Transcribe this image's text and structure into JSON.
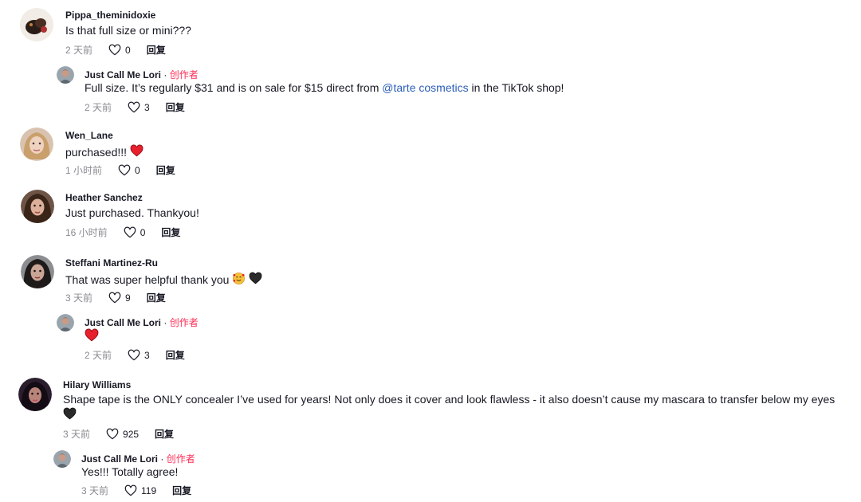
{
  "comments": [
    {
      "username": "Pippa_theminidoxie",
      "text": "Is that full size or mini???",
      "time": "2 天前",
      "likes": "0",
      "reply_label": "回复",
      "replies": [
        {
          "username": "Just Call Me Lori",
          "creator_label": "创作者",
          "text_before": "Full size. It’s regularly $31 and is on sale for $15 direct from ",
          "mention": "@tarte cosmetics",
          "text_after": " in the TikTok shop!",
          "time": "2 天前",
          "likes": "3",
          "reply_label": "回复"
        }
      ]
    },
    {
      "username": "Wen_Lane",
      "text": "purchased!!!",
      "time": "1 小时前",
      "likes": "0",
      "reply_label": "回复"
    },
    {
      "username": "Heather Sanchez",
      "text": "Just purchased. Thankyou!",
      "time": "16 小时前",
      "likes": "0",
      "reply_label": "回复"
    },
    {
      "username": "Steffani Martinez-Ru",
      "text": "That was super helpful thank you",
      "time": "3 天前",
      "likes": "9",
      "reply_label": "回复",
      "replies": [
        {
          "username": "Just Call Me Lori",
          "creator_label": "创作者",
          "time": "2 天前",
          "likes": "3",
          "reply_label": "回复"
        }
      ]
    },
    {
      "username": "Hilary Williams",
      "text": "Shape tape is the ONLY concealer I’ve used for years! Not only does it cover and look flawless - it also doesn’t cause my mascara to transfer below my eyes",
      "time": "3 天前",
      "likes": "925",
      "reply_label": "回复",
      "replies": [
        {
          "username": "Just Call Me Lori",
          "creator_label": "创作者",
          "text": "Yes!!! Totally agree!",
          "time": "3 天前",
          "likes": "119",
          "reply_label": "回复"
        }
      ]
    }
  ],
  "separator": " · ",
  "colors": {
    "creator": "#fe2c55",
    "mention": "#2b5db9",
    "meta": "#8a8b91",
    "heart_red": "#e8202d"
  }
}
